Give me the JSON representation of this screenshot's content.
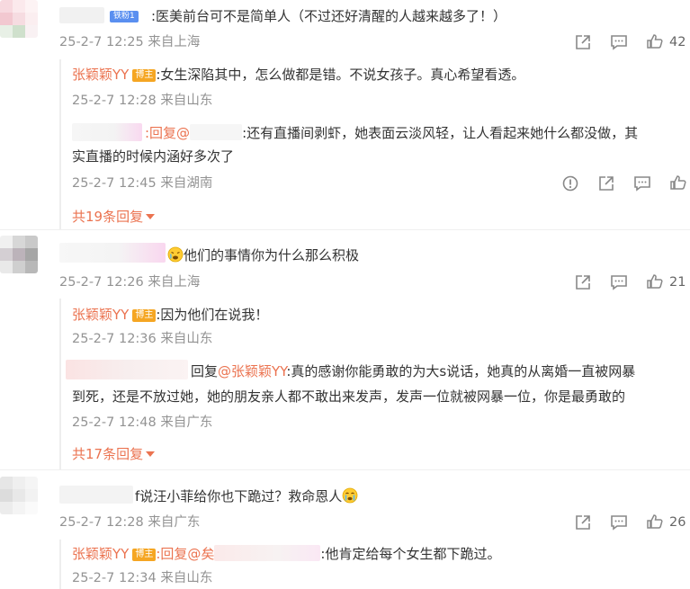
{
  "colors": {
    "username": "#eb7350",
    "meta": "#939393",
    "badge": "#f5a623",
    "fan_badge": "#5a8ff0",
    "link": "#eb7350"
  },
  "comments": [
    {
      "fan_badge": "铁粉1",
      "text": ":医美前台可不是简单人（不过还好清醒的人越来越多了！）",
      "meta": "25-2-7 12:25 来自上海",
      "likes": "42",
      "replies": [
        {
          "user": "张颖颖YY",
          "badge": "博主",
          "text": ":女生深陷其中，怎么做都是错。不说女孩子。真心希望看透。",
          "meta": "25-2-7 12:28 来自山东"
        },
        {
          "reply_prefix": ":回复@",
          "text_line1": ":还有直播间剥虾，她表面云淡风轻，让人看起来她什么都没做，其",
          "text_line2": "实直播的时候内涵好多次了",
          "meta": "25-2-7 12:45 来自湖南"
        }
      ],
      "more": "共19条回复"
    },
    {
      "text": "他们的事情你为什么那么积极",
      "meta": "25-2-7 12:26 来自上海",
      "likes": "21",
      "replies": [
        {
          "user": "张颖颖YY",
          "badge": "博主",
          "text": ":因为他们在说我！",
          "meta": "25-2-7 12:36 来自山东"
        },
        {
          "reply_prefix": "回复",
          "reply_to": "@张颖颖YY",
          "text_line1": ":真的感谢你能勇敢的为大s说话，她真的从离婚一直被网暴",
          "text_line2": "到死，还是不放过她，她的朋友亲人都不敢出来发声，发声一位就被网暴一位，你是最勇敢的",
          "meta": "25-2-7 12:48 来自广东"
        }
      ],
      "more": "共17条回复"
    },
    {
      "text": "f说汪小菲给你也下跪过？救命恩人",
      "meta": "25-2-7 12:28 来自广东",
      "likes": "26",
      "replies": [
        {
          "user": "张颖颖YY",
          "badge": "博主",
          "reply_prefix": ":回复@矣",
          "text": ":他肯定给每个女生都下跪过。",
          "meta": "25-2-7 12:34 来自山东"
        }
      ]
    }
  ]
}
